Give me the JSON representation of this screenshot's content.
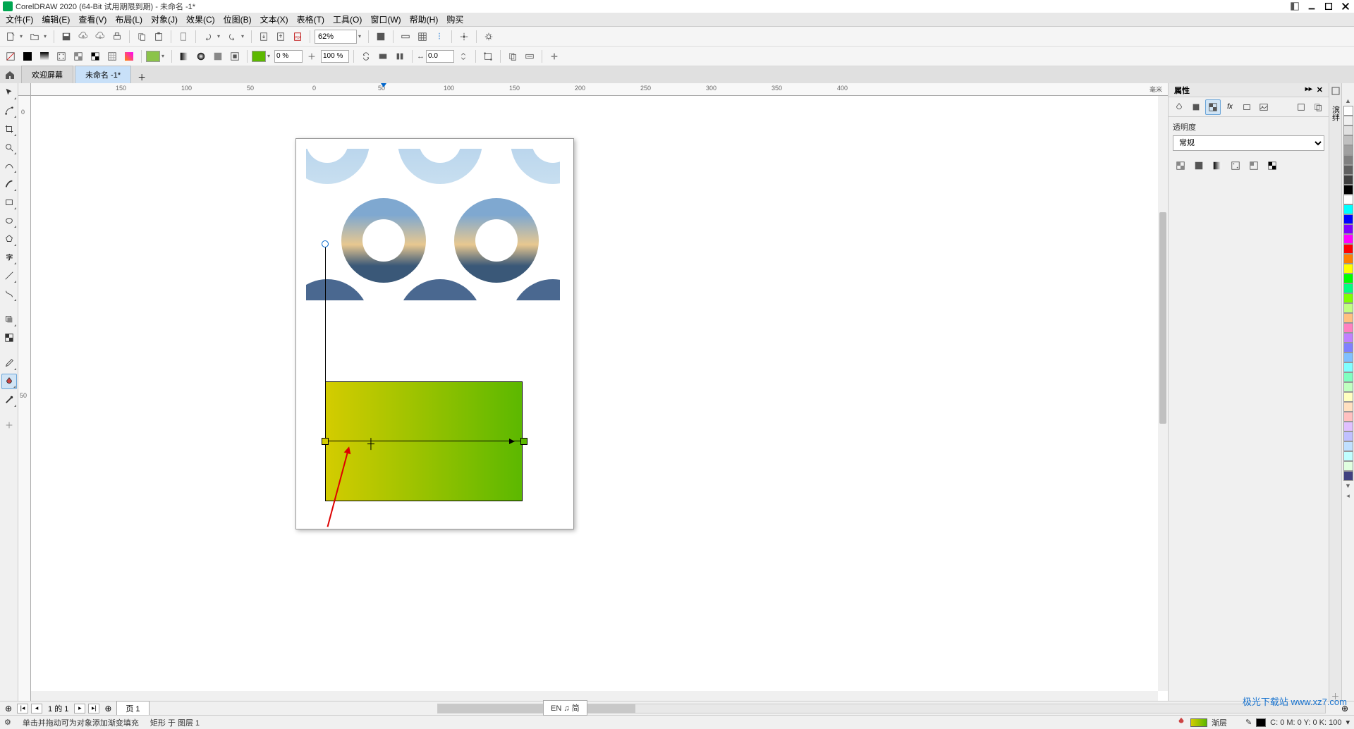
{
  "title": "CorelDRAW 2020 (64-Bit 试用期限到期) - 未命名 -1*",
  "menu": [
    "文件(F)",
    "编辑(E)",
    "查看(V)",
    "布局(L)",
    "对象(J)",
    "效果(C)",
    "位图(B)",
    "文本(X)",
    "表格(T)",
    "工具(O)",
    "窗口(W)",
    "帮助(H)",
    "购买"
  ],
  "toolbar1": {
    "zoom": "62%"
  },
  "toolbar2": {
    "fill_color": "#8bc34a",
    "merge1": "0 %",
    "merge2": "100 %",
    "rotate": "0.0",
    "grad_end": "#5cb800"
  },
  "tabs": {
    "tab1": "欢迎屏幕",
    "tab2": "未命名 -1*"
  },
  "ruler": {
    "units": "毫米",
    "h": [
      "150",
      "100",
      "50",
      "0",
      "50",
      "100",
      "150",
      "200",
      "250",
      "300",
      "350",
      "400"
    ],
    "v": [
      "0",
      "50"
    ]
  },
  "docker": {
    "title": "属性",
    "section": "透明度",
    "mode": "常规",
    "side_tab": "滨绊"
  },
  "palette": {
    "colors": [
      "#ffffff",
      "#f0f0f0",
      "#e0e0e0",
      "#c0c0c0",
      "#a0a0a0",
      "#808080",
      "#606060",
      "#404040",
      "#000000",
      "#ffffff",
      "#00ffff",
      "#0000ff",
      "#8000ff",
      "#ff00ff",
      "#ff0000",
      "#ff8000",
      "#ffff00",
      "#00ff00",
      "#00ff80",
      "#80ff00",
      "#c0ff80",
      "#ffc080",
      "#ff80c0",
      "#c080ff",
      "#8080ff",
      "#80c0ff",
      "#80ffff",
      "#80ffc0",
      "#c0ffc0",
      "#ffffc0",
      "#ffe0c0",
      "#ffc0c0",
      "#e0c0ff",
      "#c0c0ff",
      "#c0e0ff",
      "#c0ffff",
      "#e0ffe0",
      "#404080"
    ]
  },
  "page_nav": {
    "page_num": "1",
    "of": "的 1",
    "page_label": "页 1"
  },
  "status": {
    "hint": "单击并拖动可为对象添加渐变填充",
    "object": "矩形 于 图层 1",
    "ime": "EN ♫ 简",
    "fill_label": "渐层",
    "cmyk": "C: 0  M: 0  Y: 0  K: 100"
  },
  "watermark": "极光下载站  www.xz7.com"
}
